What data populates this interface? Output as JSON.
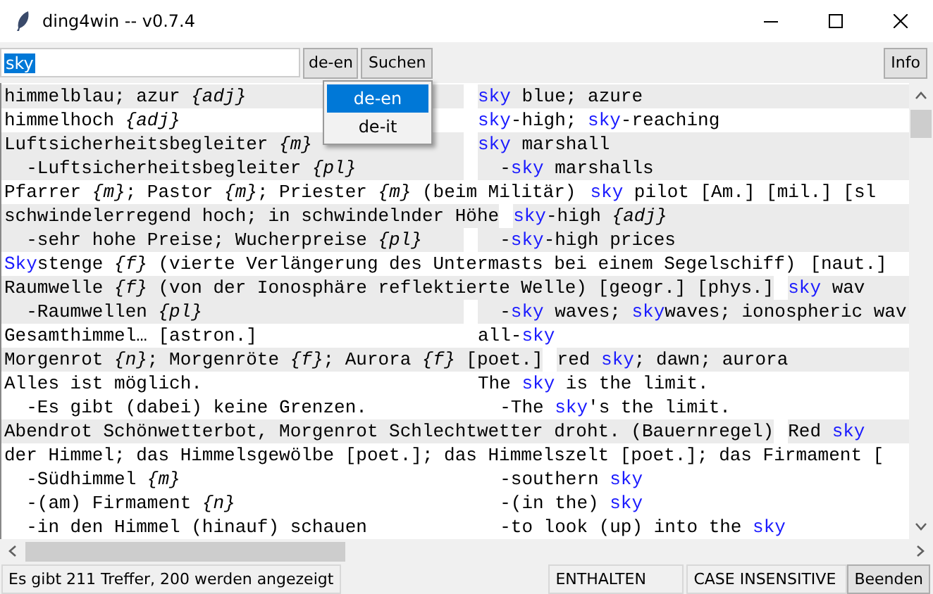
{
  "window": {
    "title": "ding4win -- v0.7.4"
  },
  "search": {
    "value": "sky",
    "text_selected": true
  },
  "language_button": {
    "label": "de-en"
  },
  "search_button": {
    "label": "Suchen"
  },
  "info_button": {
    "label": "Info"
  },
  "language_menu": [
    {
      "label": "de-en",
      "selected": true
    },
    {
      "label": "de-it",
      "selected": false
    }
  ],
  "results": [
    {
      "shaded": true,
      "de": [
        {
          "text": "himmelblau; azur ",
          "kind": "plain"
        },
        {
          "text": "{adj}",
          "kind": "tag"
        }
      ],
      "en": [
        {
          "text": "sky",
          "kind": "hit"
        },
        {
          "text": " blue; azure",
          "kind": "plain"
        }
      ]
    },
    {
      "shaded": false,
      "de": [
        {
          "text": "himmelhoch ",
          "kind": "plain"
        },
        {
          "text": "{adj}",
          "kind": "tag"
        }
      ],
      "en": [
        {
          "text": "sky",
          "kind": "hit"
        },
        {
          "text": "-high; ",
          "kind": "plain"
        },
        {
          "text": "sky",
          "kind": "hit"
        },
        {
          "text": "-reaching",
          "kind": "plain"
        }
      ]
    },
    {
      "shaded": true,
      "de": [
        {
          "text": "Luftsicherheitsbegleiter ",
          "kind": "plain"
        },
        {
          "text": "{m}",
          "kind": "tag"
        }
      ],
      "en": [
        {
          "text": "sky",
          "kind": "hit"
        },
        {
          "text": " marshall",
          "kind": "plain"
        }
      ]
    },
    {
      "shaded": true,
      "de": [
        {
          "text": "  -Luftsicherheitsbegleiter ",
          "kind": "plain"
        },
        {
          "text": "{pl}",
          "kind": "tag"
        }
      ],
      "en": [
        {
          "text": "  -",
          "kind": "plain"
        },
        {
          "text": "sky",
          "kind": "hit"
        },
        {
          "text": " marshalls",
          "kind": "plain"
        }
      ]
    },
    {
      "shaded": false,
      "de": [
        {
          "text": "Pfarrer ",
          "kind": "plain"
        },
        {
          "text": "{m}",
          "kind": "tag"
        },
        {
          "text": "; Pastor ",
          "kind": "plain"
        },
        {
          "text": "{m}",
          "kind": "tag"
        },
        {
          "text": "; Priester ",
          "kind": "plain"
        },
        {
          "text": "{m}",
          "kind": "tag"
        },
        {
          "text": " (beim Militär)",
          "kind": "plain"
        }
      ],
      "en": [
        {
          "text": "sky",
          "kind": "hit"
        },
        {
          "text": " pilot [Am.] [mil.] [sl",
          "kind": "plain"
        }
      ]
    },
    {
      "shaded": true,
      "de": [
        {
          "text": "schwindelerregend hoch; in schwindelnder Höhe",
          "kind": "plain"
        }
      ],
      "en": [
        {
          "text": "sky",
          "kind": "hit"
        },
        {
          "text": "-high ",
          "kind": "plain"
        },
        {
          "text": "{adj}",
          "kind": "tag"
        }
      ]
    },
    {
      "shaded": true,
      "de": [
        {
          "text": "  -sehr hohe Preise; Wucherpreise ",
          "kind": "plain"
        },
        {
          "text": "{pl}",
          "kind": "tag"
        }
      ],
      "en": [
        {
          "text": "  -",
          "kind": "plain"
        },
        {
          "text": "sky",
          "kind": "hit"
        },
        {
          "text": "-high prices",
          "kind": "plain"
        }
      ]
    },
    {
      "shaded": false,
      "de": [
        {
          "text": "Sky",
          "kind": "hit"
        },
        {
          "text": "stenge ",
          "kind": "plain"
        },
        {
          "text": "{f}",
          "kind": "tag"
        },
        {
          "text": " (vierte Verlängerung des Untermasts bei einem Segelschiff)",
          "kind": "plain"
        }
      ],
      "en": [
        {
          "text": "[naut.]",
          "kind": "plain"
        }
      ]
    },
    {
      "shaded": true,
      "de": [
        {
          "text": "Raumwelle ",
          "kind": "plain"
        },
        {
          "text": "{f}",
          "kind": "tag"
        },
        {
          "text": " (von der Ionosphäre reflektierte Welle) [geogr.] [phys.]",
          "kind": "plain"
        }
      ],
      "en": [
        {
          "text": "sky",
          "kind": "hit"
        },
        {
          "text": " wav",
          "kind": "plain"
        }
      ]
    },
    {
      "shaded": true,
      "de": [
        {
          "text": "  -Raumwellen ",
          "kind": "plain"
        },
        {
          "text": "{pl}",
          "kind": "tag"
        }
      ],
      "en": [
        {
          "text": "  -",
          "kind": "plain"
        },
        {
          "text": "sky",
          "kind": "hit"
        },
        {
          "text": " waves; ",
          "kind": "plain"
        },
        {
          "text": "sky",
          "kind": "hit"
        },
        {
          "text": "waves; ionospheric wav",
          "kind": "plain"
        }
      ]
    },
    {
      "shaded": false,
      "de": [
        {
          "text": "Gesamthimmel… [astron.]",
          "kind": "plain"
        }
      ],
      "en": [
        {
          "text": "all-",
          "kind": "plain"
        },
        {
          "text": "sky",
          "kind": "hit"
        }
      ]
    },
    {
      "shaded": true,
      "de": [
        {
          "text": "Morgenrot ",
          "kind": "plain"
        },
        {
          "text": "{n}",
          "kind": "tag"
        },
        {
          "text": "; Morgenröte ",
          "kind": "plain"
        },
        {
          "text": "{f}",
          "kind": "tag"
        },
        {
          "text": "; Aurora ",
          "kind": "plain"
        },
        {
          "text": "{f}",
          "kind": "tag"
        },
        {
          "text": " [poet.]",
          "kind": "plain"
        }
      ],
      "en": [
        {
          "text": "red ",
          "kind": "plain"
        },
        {
          "text": "sky",
          "kind": "hit"
        },
        {
          "text": "; dawn; aurora",
          "kind": "plain"
        }
      ]
    },
    {
      "shaded": false,
      "de": [
        {
          "text": "Alles ist möglich.",
          "kind": "plain"
        }
      ],
      "en": [
        {
          "text": "The ",
          "kind": "plain"
        },
        {
          "text": "sky",
          "kind": "hit"
        },
        {
          "text": " is the limit.",
          "kind": "plain"
        }
      ]
    },
    {
      "shaded": false,
      "de": [
        {
          "text": "  -Es gibt (dabei) keine Grenzen.",
          "kind": "plain"
        }
      ],
      "en": [
        {
          "text": "  -The ",
          "kind": "plain"
        },
        {
          "text": "sky",
          "kind": "hit"
        },
        {
          "text": "'s the limit.",
          "kind": "plain"
        }
      ]
    },
    {
      "shaded": true,
      "de": [
        {
          "text": "Abendrot Schönwetterbot, Morgenrot Schlechtwetter droht. (Bauernregel)",
          "kind": "plain"
        }
      ],
      "en": [
        {
          "text": "Red ",
          "kind": "plain"
        },
        {
          "text": "sky",
          "kind": "hit"
        }
      ]
    },
    {
      "shaded": false,
      "de": [
        {
          "text": "der Himmel; das Himmelsgewölbe [poet.]; das Himmelszelt [poet.]; das Firmament [",
          "kind": "plain"
        }
      ]
    },
    {
      "shaded": false,
      "de": [
        {
          "text": "  -Südhimmel ",
          "kind": "plain"
        },
        {
          "text": "{m}",
          "kind": "tag"
        }
      ],
      "en": [
        {
          "text": "  -southern ",
          "kind": "plain"
        },
        {
          "text": "sky",
          "kind": "hit"
        }
      ]
    },
    {
      "shaded": false,
      "de": [
        {
          "text": "  -(am) Firmament ",
          "kind": "plain"
        },
        {
          "text": "{n}",
          "kind": "tag"
        }
      ],
      "en": [
        {
          "text": "  -(in the) ",
          "kind": "plain"
        },
        {
          "text": "sky",
          "kind": "hit"
        }
      ]
    },
    {
      "shaded": false,
      "de": [
        {
          "text": "  -in den Himmel (hinauf) schauen",
          "kind": "plain"
        }
      ],
      "en": [
        {
          "text": "  -to look (up) into the ",
          "kind": "plain"
        },
        {
          "text": "sky",
          "kind": "hit"
        }
      ]
    }
  ],
  "status_bar": {
    "message": "Es gibt 211 Treffer, 200 werden angezeigt",
    "mode": "ENTHALTEN",
    "case": "CASE INSENSITIVE",
    "quit_button": "Beenden"
  }
}
